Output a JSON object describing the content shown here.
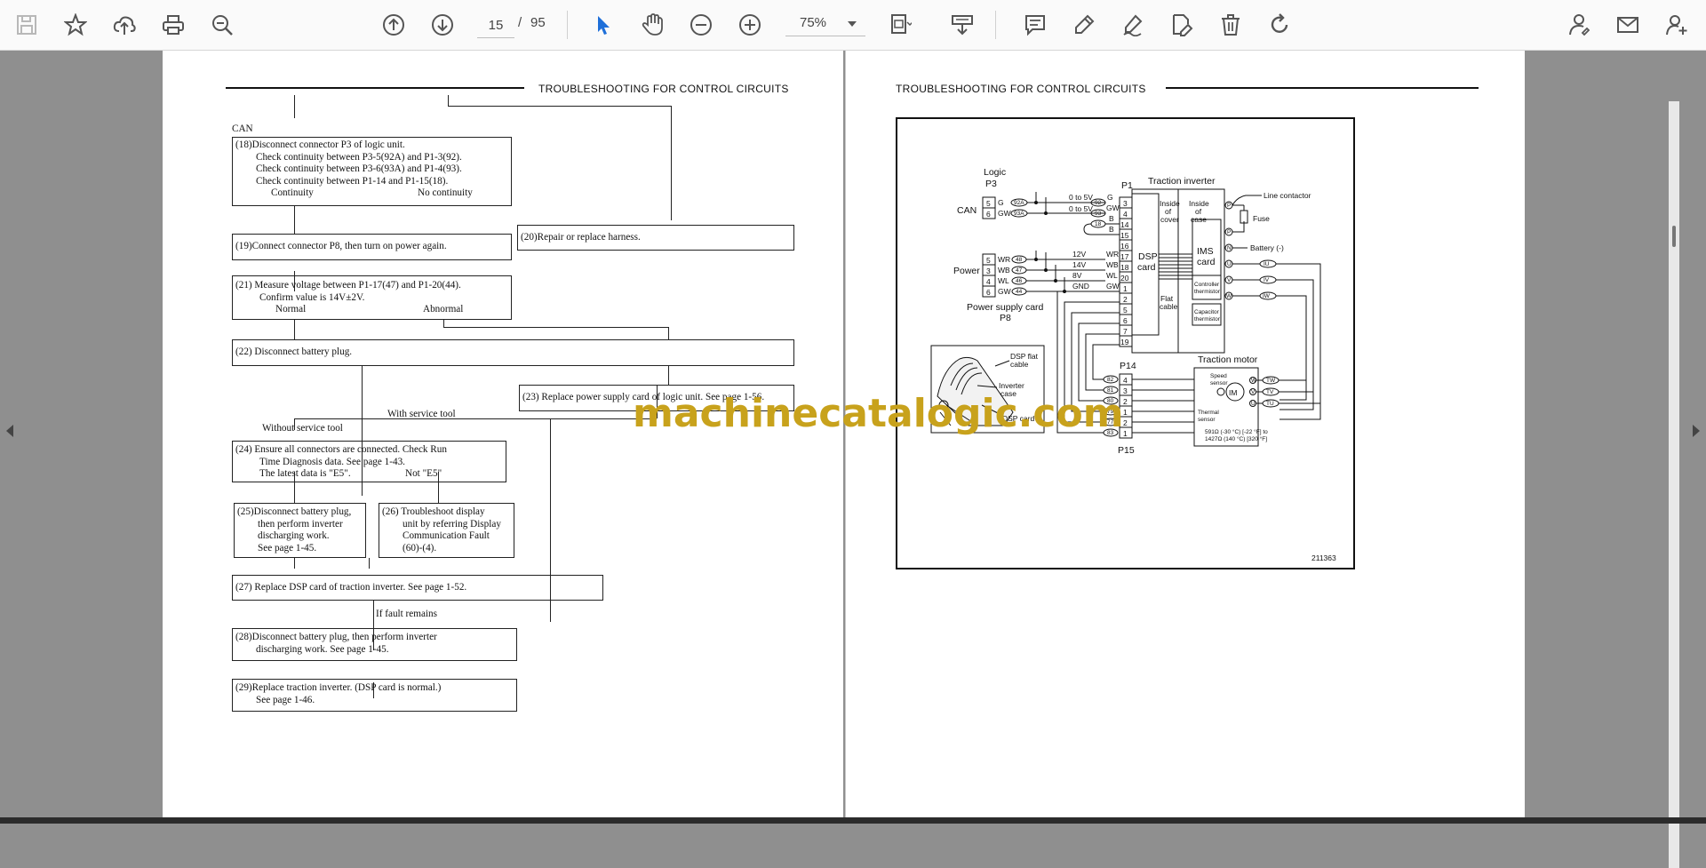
{
  "toolbar": {
    "page_current": "15",
    "page_separator": "/",
    "page_total": "95",
    "zoom": "75%"
  },
  "icons": [
    "save-icon",
    "bookmark-star-icon",
    "upload-icon",
    "print-icon",
    "zoom-out-search-icon",
    "page-up-icon",
    "page-down-icon",
    "select-cursor-icon",
    "hand-tool-icon",
    "zoom-out-icon",
    "zoom-in-icon",
    "fit-page-icon",
    "scroll-mode-icon",
    "comment-icon",
    "highlight-pen-icon",
    "draw-icon",
    "edit-text-icon",
    "delete-icon",
    "rotate-icon",
    "share-link-icon",
    "email-icon",
    "add-user-icon"
  ],
  "colors": {
    "accent": "#1e6fd9",
    "watermark": "#c8a21c"
  },
  "left_page": {
    "header": "TROUBLESHOOTING  FOR  CONTROL  CIRCUITS",
    "can_label": "CAN",
    "box18": [
      "(18)Disconnect connector P3 of logic unit.",
      "Check continuity between P3-5(92A) and P1-3(92).",
      "Check continuity between P3-6(93A) and P1-4(93).",
      "Check continuity between P1-14 and P1-15(18)."
    ],
    "continuity": "Continuity",
    "no_continuity": "No continuity",
    "box19": "(19)Connect connector P8, then turn on power again.",
    "box20": "(20)Repair or replace harness.",
    "box21": [
      "(21) Measure voltage between P1-17(47) and P1-20(44).",
      "Confirm value is 14V±2V."
    ],
    "normal": "Normal",
    "abnormal": "Abnormal",
    "box22": "(22) Disconnect battery plug.",
    "box23": "(23) Replace power supply card of logic unit. See page 1-56.",
    "without_tool": "Without service tool",
    "with_tool": "With service tool",
    "box24": [
      "(24)  Ensure all connectors are connected. Check Run",
      "Time Diagnosis data.  See page 1-43."
    ],
    "latest_e5": "The latest data is \"E5\".",
    "not_e5": "Not \"E5\"",
    "box25": [
      "(25)Disconnect battery plug,",
      "then perform inverter",
      "discharging work.",
      "See page 1-45."
    ],
    "box26": [
      "(26) Troubleshoot display",
      "unit by referring Display",
      "Communication Fault",
      "(60)-(4)."
    ],
    "box27": "(27)  Replace DSP card of traction inverter. See page 1-52.",
    "if_fault": "If fault remains",
    "box28": [
      "(28)Disconnect battery plug, then perform inverter",
      "discharging work. See page 1-45."
    ],
    "box29": [
      "(29)Replace traction inverter. (DSP card is normal.)",
      "See page 1-46."
    ]
  },
  "right_page": {
    "header": "TROUBLESHOOTING  FOR  CONTROL  CIRCUITS",
    "logic": "Logic",
    "p3": "P3",
    "can": "CAN",
    "power": "Power",
    "power_supply_card": "Power supply card",
    "p8": "P8",
    "p1": "P1",
    "traction_inverter": "Traction inverter",
    "inside_of_cover": [
      "Inside",
      "of",
      "cover"
    ],
    "inside_of_case": [
      "Inside",
      "of",
      "case"
    ],
    "line_contactor": "Line contactor",
    "fuse": "Fuse",
    "battery_minus": "Battery (-)",
    "dsp_card": [
      "DSP",
      "card"
    ],
    "ims_card": [
      "IMS",
      "card"
    ],
    "flat_cable": [
      "Flat",
      "cable"
    ],
    "controller_thermistor": [
      "Controller",
      "thermistor"
    ],
    "capacitor_thermistor": [
      "Capacitor",
      "thermistor"
    ],
    "v0to5a": "0 to 5V",
    "v0to5b": "0 to 5V",
    "v12": "12V",
    "v14": "14V",
    "v8": "8V",
    "gnd": "GND",
    "p3_pins": [
      "5",
      "6"
    ],
    "p3_letters": [
      "G",
      "GW"
    ],
    "p8_pins": [
      "5",
      "3",
      "4",
      "6"
    ],
    "p8_letters": [
      "WR",
      "WB",
      "WL",
      "GW"
    ],
    "p3_wires": [
      "92A",
      "93A"
    ],
    "p8_wires": [
      "48",
      "47",
      "46",
      "44"
    ],
    "p1_wires": [
      "92",
      "93",
      "18"
    ],
    "p1_pins": [
      "3",
      "4",
      "14",
      "15",
      "16",
      "17",
      "18",
      "20",
      "1",
      "2",
      "5",
      "6",
      "7",
      "19"
    ],
    "p1_letters": [
      "G",
      "GW",
      "B",
      "B",
      "WR",
      "WB",
      "WL",
      "GW"
    ],
    "inverter_terminals": [
      "P",
      "N",
      "U",
      "V",
      "W"
    ],
    "inverter_terminal_p_top": "P",
    "u_wires": [
      "IU",
      "IV",
      "IW"
    ],
    "p14": "P14",
    "p15": "P15",
    "traction_motor": "Traction motor",
    "speed_sensor": [
      "Speed",
      "sensor"
    ],
    "thermal_sensor": [
      "Thermal",
      "sensor"
    ],
    "im": "IM",
    "motor_wires": [
      "TW",
      "TV",
      "TU"
    ],
    "p14_pins": [
      "4",
      "3",
      "2"
    ],
    "p15_pins": [
      "1",
      "2",
      "1"
    ],
    "p14_wires": [
      "82",
      "81",
      "80"
    ],
    "p15_wires": [
      "79",
      "77",
      "83"
    ],
    "motor_term": [
      "W",
      "V",
      "U"
    ],
    "thermal_note": [
      "591Ω (-30 °C) [-22 °F] to",
      "1427Ω (140 °C) [320 °F]"
    ],
    "dsp_flat_cable": [
      "DSP flat",
      "cable"
    ],
    "inverter_case": [
      "Inverter",
      "case"
    ],
    "inset_dsp_card": "DSP card",
    "figure_no": "211363"
  },
  "watermark": "machinecatalogic.com"
}
